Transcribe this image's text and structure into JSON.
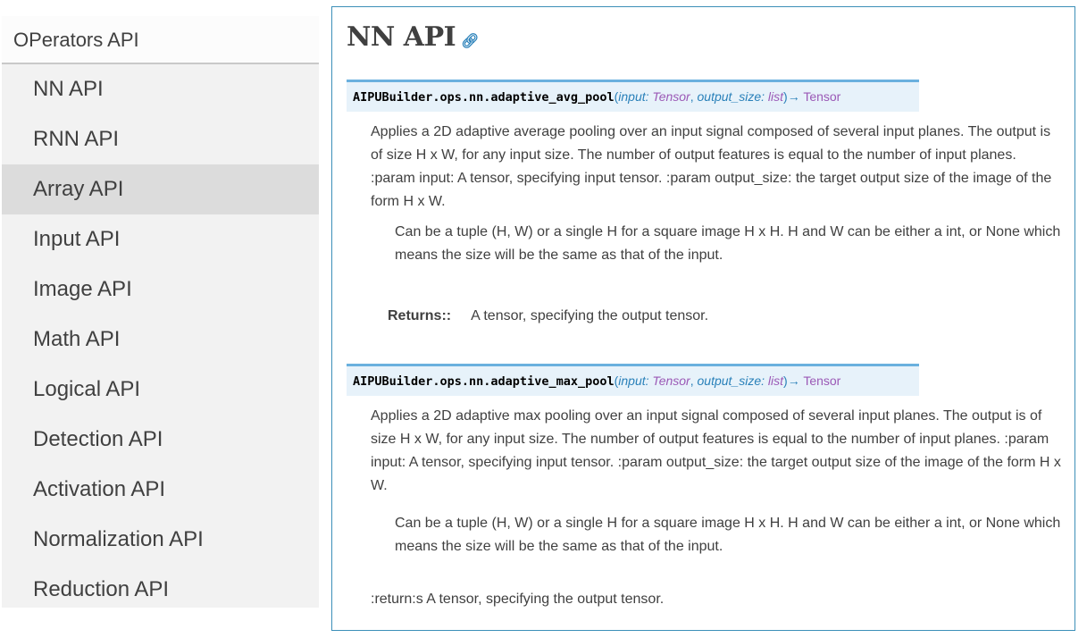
{
  "sidebar": {
    "header": "OPerators API",
    "items": [
      {
        "label": "NN API",
        "active": false
      },
      {
        "label": "RNN API",
        "active": false
      },
      {
        "label": "Array API",
        "active": true
      },
      {
        "label": "Input API",
        "active": false
      },
      {
        "label": "Image API",
        "active": false
      },
      {
        "label": "Math API",
        "active": false
      },
      {
        "label": "Logical API",
        "active": false
      },
      {
        "label": "Detection API",
        "active": false
      },
      {
        "label": "Activation API",
        "active": false
      },
      {
        "label": "Normalization API",
        "active": false
      },
      {
        "label": "Reduction API",
        "active": false
      }
    ]
  },
  "main": {
    "title": "NN API",
    "headerlink_icon": "link-icon",
    "functions": [
      {
        "name": "AIPUBuilder.ops.nn.adaptive_avg_pool",
        "open_paren": "(",
        "p1_name": "input:",
        "p1_type": "Tensor",
        "sep": ", ",
        "p2_name": "output_size:",
        "p2_type": "list",
        "close_paren": ")",
        "arrow": "→",
        "return_type": "Tensor",
        "description": "Applies a 2D adaptive average pooling over an input signal composed of several input planes. The output is of size H x W, for any input size. The number of output features is equal to the number of input planes. :param input: A tensor, specifying input tensor. :param output_size: the target output size of the image of the form H x W.",
        "detail": "Can be a tuple (H, W) or a single H for a square image H x H. H and W can be either a int, or None which means the size will be the same as that of the input.",
        "returns_label": "Returns::",
        "returns_text": "A tensor, specifying the output tensor."
      },
      {
        "name": "AIPUBuilder.ops.nn.adaptive_max_pool",
        "open_paren": "(",
        "p1_name": "input:",
        "p1_type": "Tensor",
        "sep": ", ",
        "p2_name": "output_size:",
        "p2_type": "list",
        "close_paren": ")",
        "arrow": "→",
        "return_type": "Tensor",
        "description": "Applies a 2D adaptive max pooling over an input signal composed of several input planes. The output is of size H x W, for any input size. The number of output features is equal to the number of input planes. :param input: A tensor, specifying input tensor. :param output_size: the target output size of the image of the form H x W.",
        "detail": "Can be a tuple (H, W) or a single H for a square image H x H. H and W can be either a int, or None which means the size will be the same as that of the input.",
        "return_note": ":return:s A tensor, specifying the output tensor."
      }
    ]
  }
}
